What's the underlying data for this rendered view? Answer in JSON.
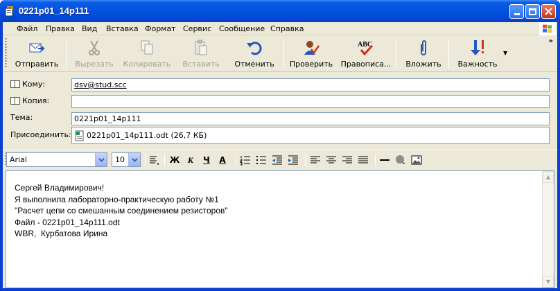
{
  "window": {
    "title": "0221p01_14p111",
    "icons": {
      "app": "envelope-edit-icon",
      "minimize": "minimize-icon",
      "maximize": "maximize-icon",
      "close": "close-icon"
    }
  },
  "menu": {
    "items": [
      "Файл",
      "Правка",
      "Вид",
      "Вставка",
      "Формат",
      "Сервис",
      "Сообщение",
      "Справка"
    ]
  },
  "toolbar": {
    "buttons": [
      {
        "label": "Отправить",
        "icon": "send-icon",
        "enabled": true
      },
      {
        "label": "Вырезать",
        "icon": "scissors-icon",
        "enabled": false
      },
      {
        "label": "Копировать",
        "icon": "copy-icon",
        "enabled": false
      },
      {
        "label": "Вставить",
        "icon": "paste-icon",
        "enabled": false
      },
      {
        "label": "Отменить",
        "icon": "undo-icon",
        "enabled": true
      },
      {
        "label": "Проверить",
        "icon": "check-names-icon",
        "enabled": true
      },
      {
        "label": "Правописа...",
        "icon": "spelling-icon",
        "enabled": true
      },
      {
        "label": "Вложить",
        "icon": "paperclip-icon",
        "enabled": true
      },
      {
        "label": "Важность",
        "icon": "priority-icon",
        "enabled": true
      }
    ],
    "more": "»"
  },
  "headers": {
    "to_label": "Кому:",
    "to_value": "dsv@stud.scc",
    "cc_label": "Копия:",
    "cc_value": "",
    "subject_label": "Тема:",
    "subject_value": "0221p01_14p111",
    "attach_label": "Присоединить:",
    "attach_value": "0221p01_14p111.odt (26,7 КБ)"
  },
  "format": {
    "font": "Arial",
    "size": "10",
    "bold": "Ж",
    "italic": "К",
    "underline": "Ч",
    "font_color": "А"
  },
  "body": {
    "text": "Сергей Владимирович!\nЯ выполнила лабораторно-практическую работу №1\n\"Расчет цепи со смешанным соединением резисторов\"\nФайл - 0221p01_14p111.odt\nWBR,  Курбатова Ирина"
  },
  "colors": {
    "titlebar": "#0451de",
    "chrome": "#ece9d8",
    "field_border": "#7f9db9"
  }
}
